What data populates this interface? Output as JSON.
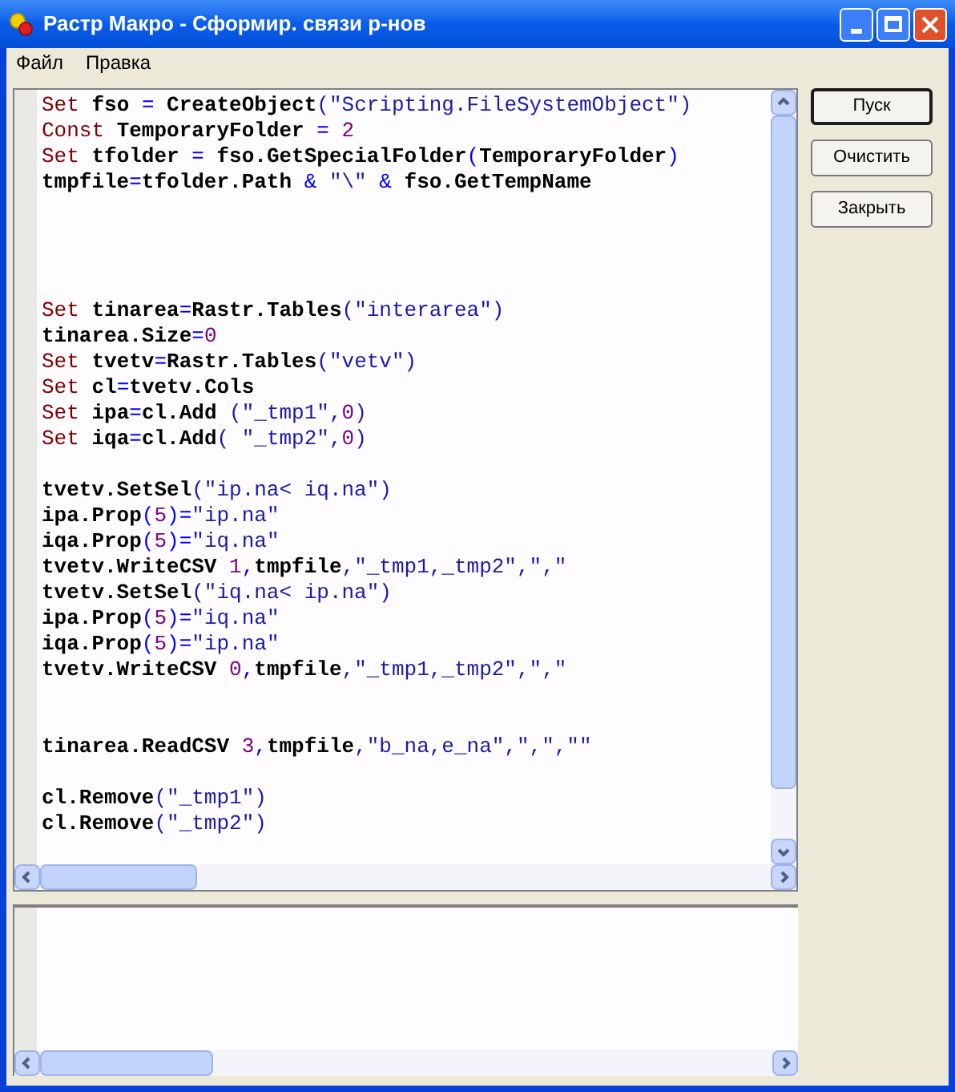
{
  "window": {
    "title": "Растр Макро - Сформир. связи р-нов"
  },
  "menu": [
    "Файл",
    "Правка"
  ],
  "editor": {
    "lines": [
      {
        "kind": "code",
        "tokens": [
          {
            "kind": "kw",
            "text": "Set "
          },
          {
            "kind": "id",
            "text": "fso "
          },
          {
            "kind": "op",
            "text": "= "
          },
          {
            "kind": "id",
            "text": "CreateObject"
          },
          {
            "kind": "str",
            "text": "(\"Scripting.FileSystemObject\")"
          }
        ]
      },
      {
        "kind": "code",
        "tokens": [
          {
            "kind": "kw",
            "text": "Const "
          },
          {
            "kind": "id",
            "text": "TemporaryFolder "
          },
          {
            "kind": "op",
            "text": "= "
          },
          {
            "kind": "num",
            "text": "2"
          }
        ]
      },
      {
        "kind": "code",
        "tokens": [
          {
            "kind": "kw",
            "text": "Set "
          },
          {
            "kind": "id",
            "text": "tfolder "
          },
          {
            "kind": "op",
            "text": "= "
          },
          {
            "kind": "id",
            "text": "fso.GetSpecialFolder"
          },
          {
            "kind": "op",
            "text": "("
          },
          {
            "kind": "id",
            "text": "TemporaryFolder"
          },
          {
            "kind": "op",
            "text": ")"
          }
        ]
      },
      {
        "kind": "code",
        "tokens": [
          {
            "kind": "id",
            "text": "tmpfile"
          },
          {
            "kind": "op",
            "text": "="
          },
          {
            "kind": "id",
            "text": "tfolder.Path "
          },
          {
            "kind": "op",
            "text": "& "
          },
          {
            "kind": "str",
            "text": "\"\\\" "
          },
          {
            "kind": "op",
            "text": "& "
          },
          {
            "kind": "id",
            "text": "fso.GetTempName"
          }
        ]
      },
      {
        "kind": "blank"
      },
      {
        "kind": "blank"
      },
      {
        "kind": "blank"
      },
      {
        "kind": "blank"
      },
      {
        "kind": "code",
        "tokens": [
          {
            "kind": "kw",
            "text": "Set "
          },
          {
            "kind": "id",
            "text": "tinarea"
          },
          {
            "kind": "op",
            "text": "="
          },
          {
            "kind": "id",
            "text": "Rastr.Tables"
          },
          {
            "kind": "str",
            "text": "(\"interarea\")"
          }
        ]
      },
      {
        "kind": "code",
        "tokens": [
          {
            "kind": "id",
            "text": "tinarea.Size"
          },
          {
            "kind": "op",
            "text": "="
          },
          {
            "kind": "num",
            "text": "0"
          }
        ]
      },
      {
        "kind": "code",
        "tokens": [
          {
            "kind": "kw",
            "text": "Set "
          },
          {
            "kind": "id",
            "text": "tvetv"
          },
          {
            "kind": "op",
            "text": "="
          },
          {
            "kind": "id",
            "text": "Rastr.Tables"
          },
          {
            "kind": "str",
            "text": "(\"vetv\")"
          }
        ]
      },
      {
        "kind": "code",
        "tokens": [
          {
            "kind": "kw",
            "text": "Set "
          },
          {
            "kind": "id",
            "text": "cl"
          },
          {
            "kind": "op",
            "text": "="
          },
          {
            "kind": "id",
            "text": "tvetv.Cols"
          }
        ]
      },
      {
        "kind": "code",
        "tokens": [
          {
            "kind": "kw",
            "text": "Set "
          },
          {
            "kind": "id",
            "text": "ipa"
          },
          {
            "kind": "op",
            "text": "="
          },
          {
            "kind": "id",
            "text": "cl.Add "
          },
          {
            "kind": "str",
            "text": "(\"_tmp1\","
          },
          {
            "kind": "num",
            "text": "0"
          },
          {
            "kind": "str",
            "text": ")"
          }
        ]
      },
      {
        "kind": "code",
        "tokens": [
          {
            "kind": "kw",
            "text": "Set "
          },
          {
            "kind": "id",
            "text": "iqa"
          },
          {
            "kind": "op",
            "text": "="
          },
          {
            "kind": "id",
            "text": "cl.Add"
          },
          {
            "kind": "str",
            "text": "( \"_tmp2\","
          },
          {
            "kind": "num",
            "text": "0"
          },
          {
            "kind": "str",
            "text": ")"
          }
        ]
      },
      {
        "kind": "blank"
      },
      {
        "kind": "code",
        "tokens": [
          {
            "kind": "id",
            "text": "tvetv.SetSel"
          },
          {
            "kind": "str",
            "text": "(\"ip.na< iq.na\")"
          }
        ]
      },
      {
        "kind": "code",
        "tokens": [
          {
            "kind": "id",
            "text": "ipa.Prop"
          },
          {
            "kind": "op",
            "text": "("
          },
          {
            "kind": "num",
            "text": "5"
          },
          {
            "kind": "op",
            "text": ")="
          },
          {
            "kind": "str",
            "text": "\"ip.na\""
          }
        ]
      },
      {
        "kind": "code",
        "tokens": [
          {
            "kind": "id",
            "text": "iqa.Prop"
          },
          {
            "kind": "op",
            "text": "("
          },
          {
            "kind": "num",
            "text": "5"
          },
          {
            "kind": "op",
            "text": ")="
          },
          {
            "kind": "str",
            "text": "\"iq.na\""
          }
        ]
      },
      {
        "kind": "code",
        "tokens": [
          {
            "kind": "id",
            "text": "tvetv.WriteCSV "
          },
          {
            "kind": "num",
            "text": "1"
          },
          {
            "kind": "op",
            "text": ","
          },
          {
            "kind": "id",
            "text": "tmpfile"
          },
          {
            "kind": "str",
            "text": ",\"_tmp1,_tmp2\",\",\""
          }
        ]
      },
      {
        "kind": "code",
        "tokens": [
          {
            "kind": "id",
            "text": "tvetv.SetSel"
          },
          {
            "kind": "str",
            "text": "(\"iq.na< ip.na\")"
          }
        ]
      },
      {
        "kind": "code",
        "tokens": [
          {
            "kind": "id",
            "text": "ipa.Prop"
          },
          {
            "kind": "op",
            "text": "("
          },
          {
            "kind": "num",
            "text": "5"
          },
          {
            "kind": "op",
            "text": ")="
          },
          {
            "kind": "str",
            "text": "\"iq.na\""
          }
        ]
      },
      {
        "kind": "code",
        "tokens": [
          {
            "kind": "id",
            "text": "iqa.Prop"
          },
          {
            "kind": "op",
            "text": "("
          },
          {
            "kind": "num",
            "text": "5"
          },
          {
            "kind": "op",
            "text": ")="
          },
          {
            "kind": "str",
            "text": "\"ip.na\""
          }
        ]
      },
      {
        "kind": "code",
        "tokens": [
          {
            "kind": "id",
            "text": "tvetv.WriteCSV "
          },
          {
            "kind": "num",
            "text": "0"
          },
          {
            "kind": "op",
            "text": ","
          },
          {
            "kind": "id",
            "text": "tmpfile"
          },
          {
            "kind": "str",
            "text": ",\"_tmp1,_tmp2\",\",\""
          }
        ]
      },
      {
        "kind": "blank"
      },
      {
        "kind": "blank"
      },
      {
        "kind": "code",
        "tokens": [
          {
            "kind": "id",
            "text": "tinarea.ReadCSV "
          },
          {
            "kind": "num",
            "text": "3"
          },
          {
            "kind": "op",
            "text": ","
          },
          {
            "kind": "id",
            "text": "tmpfile"
          },
          {
            "kind": "str",
            "text": ",\"b_na,e_na\",\",\",\"\""
          }
        ]
      },
      {
        "kind": "blank"
      },
      {
        "kind": "code",
        "tokens": [
          {
            "kind": "id",
            "text": "cl.Remove"
          },
          {
            "kind": "str",
            "text": "(\"_tmp1\")"
          }
        ]
      },
      {
        "kind": "code",
        "tokens": [
          {
            "kind": "id",
            "text": "cl.Remove"
          },
          {
            "kind": "str",
            "text": "(\"_tmp2\")"
          }
        ]
      }
    ]
  },
  "buttons": [
    {
      "label": "Пуск",
      "default": true
    },
    {
      "label": "Очистить",
      "default": false
    },
    {
      "label": "Закрыть",
      "default": false
    }
  ]
}
